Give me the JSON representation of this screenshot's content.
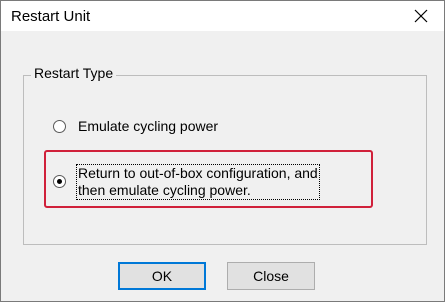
{
  "window": {
    "title": "Restart Unit",
    "close_icon": "close-icon"
  },
  "group": {
    "legend": "Restart Type"
  },
  "options": [
    {
      "label": "Emulate cycling power",
      "checked": false
    },
    {
      "label_line1": "Return to out-of-box configuration, and",
      "label_line2": "then emulate cycling power.",
      "checked": true
    }
  ],
  "buttons": {
    "ok": "OK",
    "close": "Close"
  },
  "colors": {
    "highlight": "#d0203a",
    "default_button_border": "#0078d7"
  }
}
